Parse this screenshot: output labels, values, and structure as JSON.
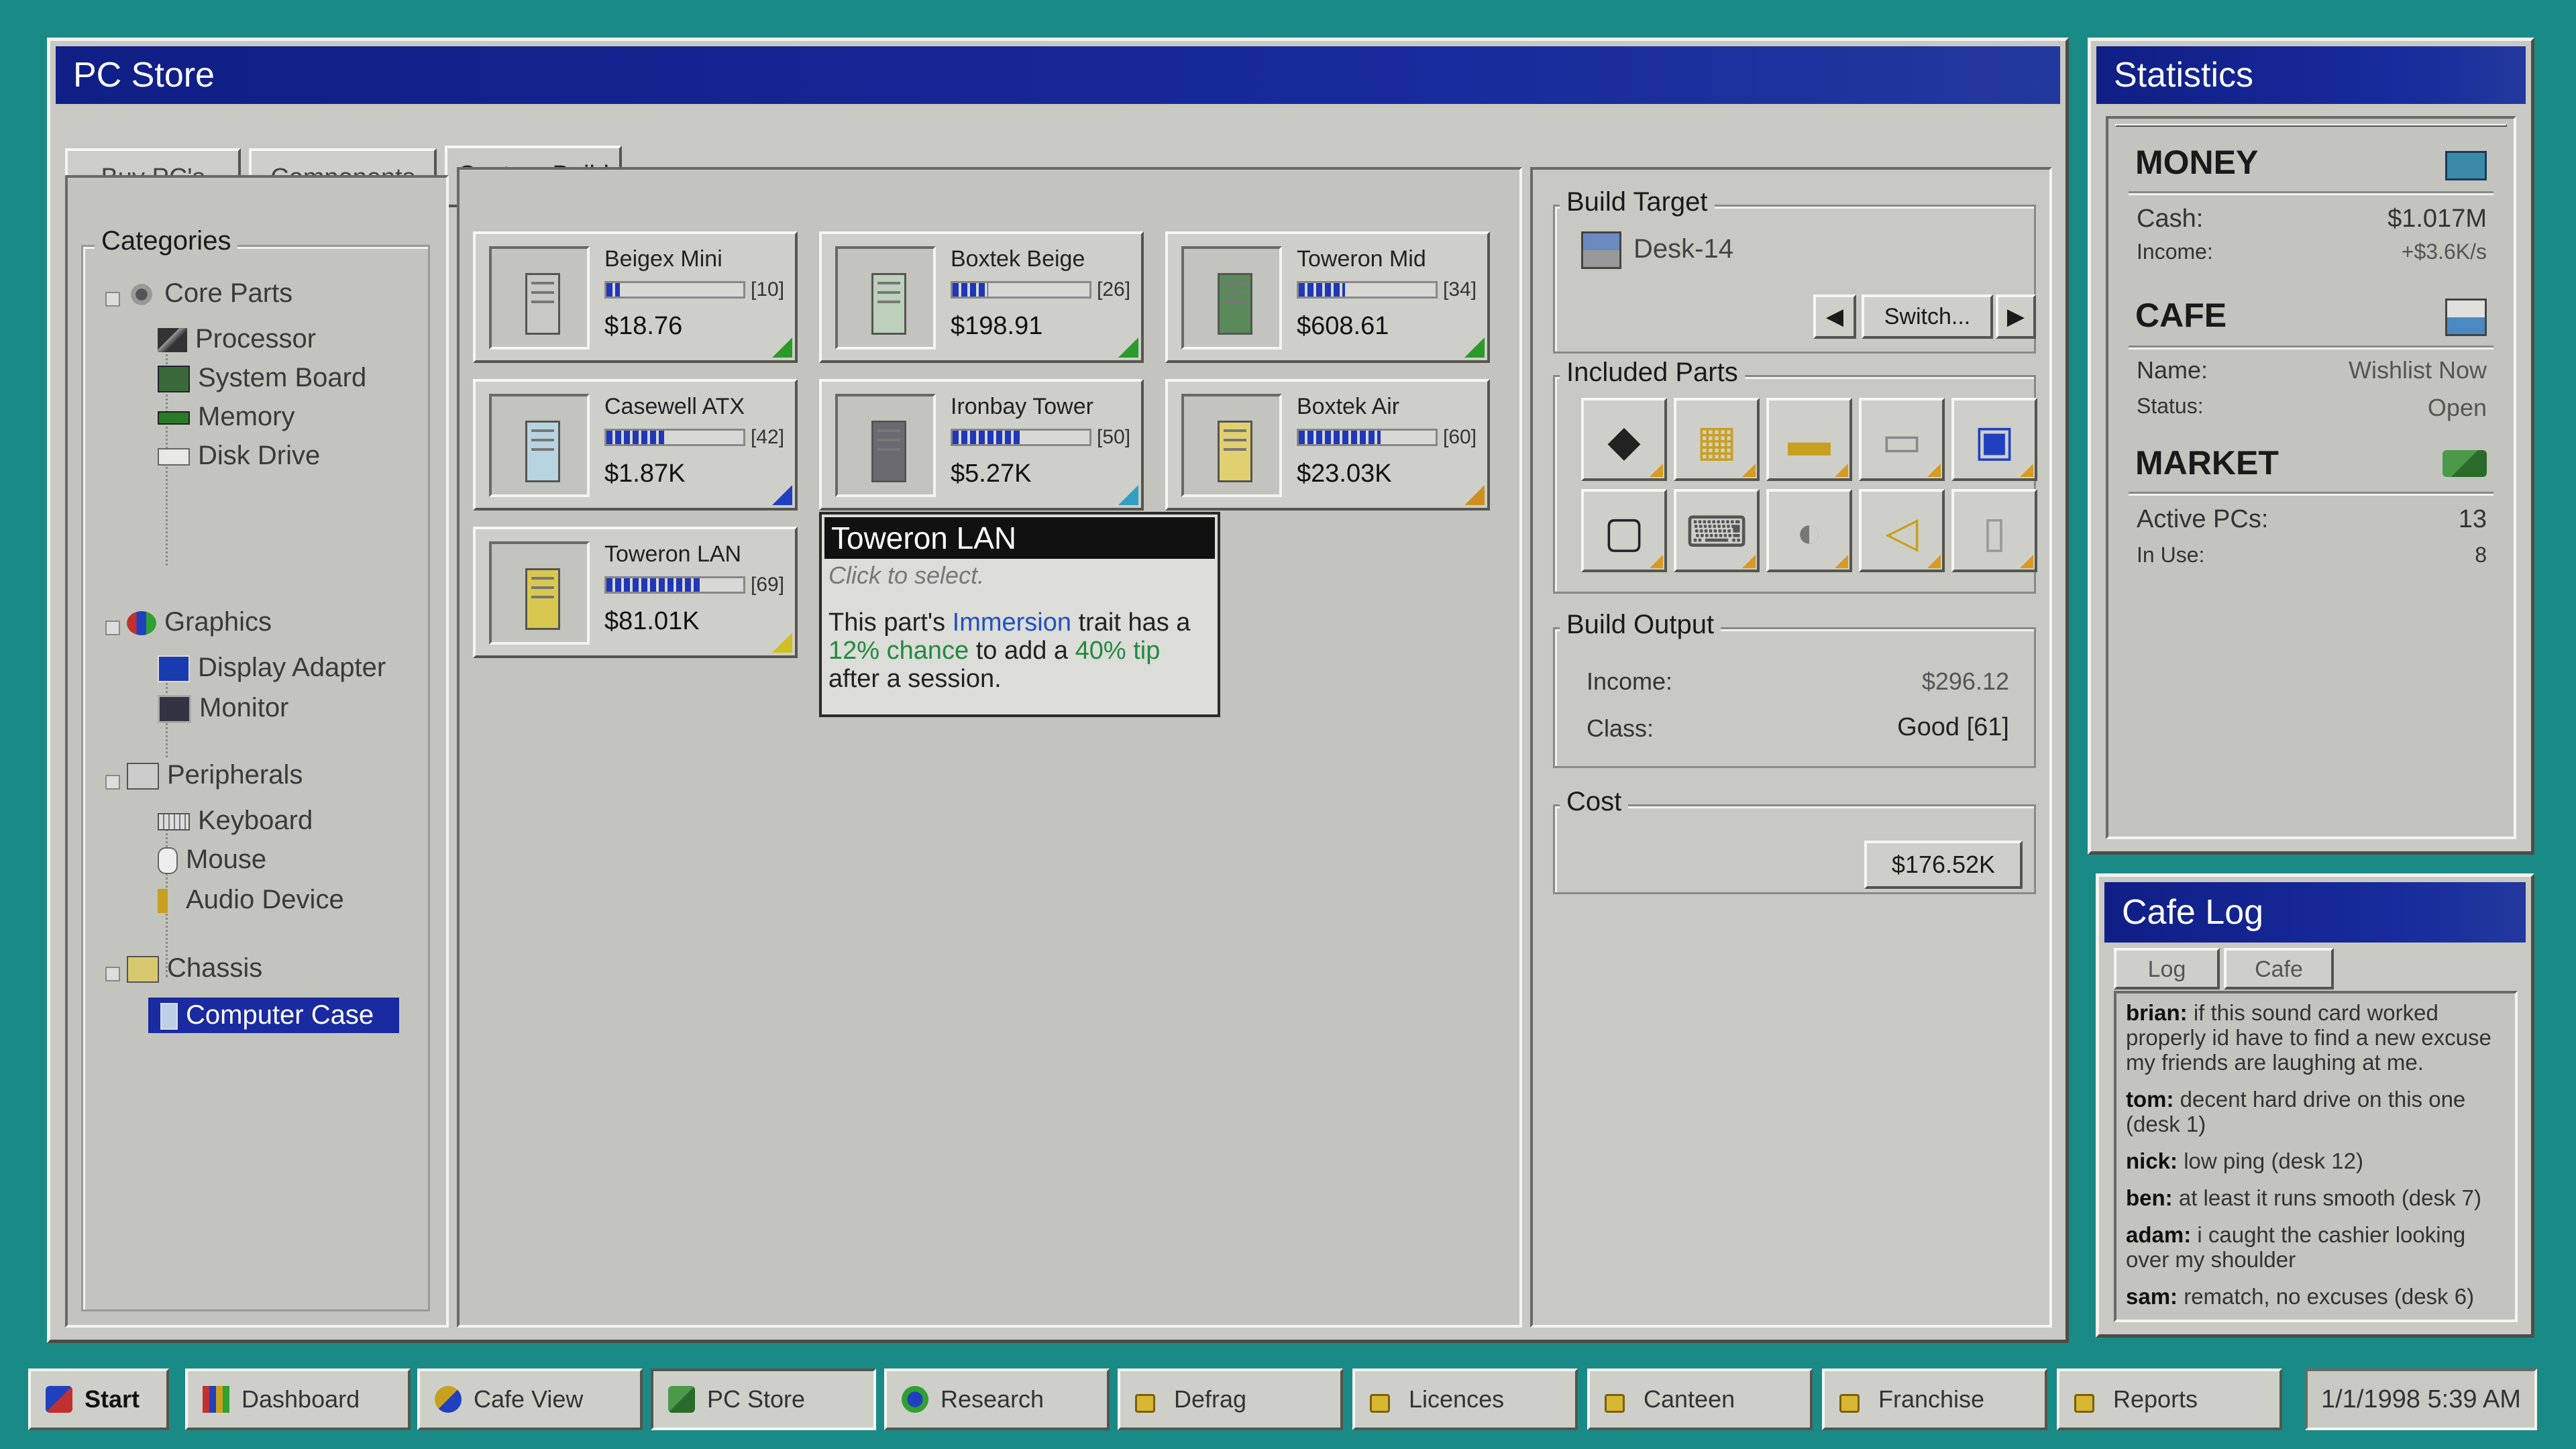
{
  "pc_store": {
    "title": "PC Store",
    "tabs": [
      "Buy PC's",
      "Components",
      "Custom Build"
    ],
    "active_tab": 2,
    "categories": {
      "label": "Categories",
      "groups": [
        {
          "label": "Core Parts",
          "items": [
            "Processor",
            "System Board",
            "Memory",
            "Disk Drive"
          ]
        },
        {
          "label": "Graphics",
          "items": [
            "Display Adapter",
            "Monitor"
          ]
        },
        {
          "label": "Peripherals",
          "items": [
            "Keyboard",
            "Mouse",
            "Audio Device"
          ]
        },
        {
          "label": "Chassis",
          "items": [
            "Computer Case"
          ]
        }
      ],
      "selected": "Computer Case"
    },
    "cases": [
      {
        "name": "Beigex Mini",
        "level": "[10]",
        "level_value": 10,
        "price": "$18.76",
        "color": "#c8c8c4",
        "corner": "#2a9a2a"
      },
      {
        "name": "Boxtek Beige",
        "level": "[26]",
        "level_value": 26,
        "price": "$198.91",
        "color": "#bcd0bc",
        "corner": "#2a9a2a"
      },
      {
        "name": "Toweron Mid",
        "level": "[34]",
        "level_value": 34,
        "price": "$608.61",
        "color": "#5a8a5a",
        "corner": "#2a9a2a"
      },
      {
        "name": "Casewell ATX",
        "level": "[42]",
        "level_value": 42,
        "price": "$1.87K",
        "color": "#b8d4e0",
        "corner": "#2040c0"
      },
      {
        "name": "Ironbay Tower",
        "level": "[50]",
        "level_value": 50,
        "price": "$5.27K",
        "color": "#6a6a70",
        "corner": "#30a0c0"
      },
      {
        "name": "Boxtek Air",
        "level": "[60]",
        "level_value": 60,
        "price": "$23.03K",
        "color": "#e0d070",
        "corner": "#d09020"
      },
      {
        "name": "Toweron LAN",
        "level": "[69]",
        "level_value": 69,
        "price": "$81.01K",
        "color": "#d8c850",
        "corner": "#d0c020"
      }
    ],
    "tooltip": {
      "title": "Toweron LAN",
      "subtitle": "Click to select.",
      "desc_1": "This part's ",
      "trait": "Immersion",
      "desc_2": " trait has a ",
      "chance": "12% chance",
      "desc_3": " to add a ",
      "tip": "40% tip",
      "desc_4": " after a session."
    },
    "build_target": {
      "label": "Build Target",
      "desk": "Desk-14",
      "switch_label": "Switch..."
    },
    "included_parts": {
      "label": "Included Parts",
      "icons": [
        "processor-icon",
        "system-board-icon",
        "memory-icon",
        "disk-drive-icon",
        "display-adapter-icon",
        "monitor-icon",
        "keyboard-icon",
        "mouse-icon",
        "audio-device-icon",
        "computer-case-icon"
      ]
    },
    "build_output": {
      "label": "Build Output",
      "income_label": "Income:",
      "income": "$296.12",
      "class_label": "Class:",
      "class": "Good [61]"
    },
    "cost": {
      "label": "Cost",
      "value": "$176.52K"
    }
  },
  "statistics": {
    "title": "Statistics",
    "money": {
      "heading": "MONEY",
      "cash_label": "Cash:",
      "cash": "$1.017M",
      "income_label": "Income:",
      "income": "+$3.6K/s"
    },
    "cafe": {
      "heading": "CAFE",
      "name_label": "Name:",
      "name": "Wishlist Now",
      "status_label": "Status:",
      "status": "Open"
    },
    "market": {
      "heading": "MARKET",
      "active_label": "Active PCs:",
      "active": "13",
      "inuse_label": "In Use:",
      "inuse": "8"
    }
  },
  "cafe_log": {
    "title": "Cafe Log",
    "tabs": [
      "Log",
      "Cafe"
    ],
    "entries": [
      {
        "user": "brian:",
        "text": " if this sound card worked properly id have to find a new excuse my friends are laughing at me."
      },
      {
        "user": "tom:",
        "text": " decent hard drive on this one (desk 1)"
      },
      {
        "user": "nick:",
        "text": " low ping (desk 12)"
      },
      {
        "user": "ben:",
        "text": " at least it runs smooth (desk 7)"
      },
      {
        "user": "adam:",
        "text": " i caught the cashier looking over my shoulder"
      },
      {
        "user": "sam:",
        "text": " rematch, no excuses (desk 6)"
      }
    ]
  },
  "taskbar": {
    "start": "Start",
    "items": [
      "Dashboard",
      "Cafe View",
      "PC Store",
      "Research",
      "Defrag",
      "Licences",
      "Canteen",
      "Franchise",
      "Reports"
    ],
    "clock": "1/1/1998 5:39 AM"
  }
}
